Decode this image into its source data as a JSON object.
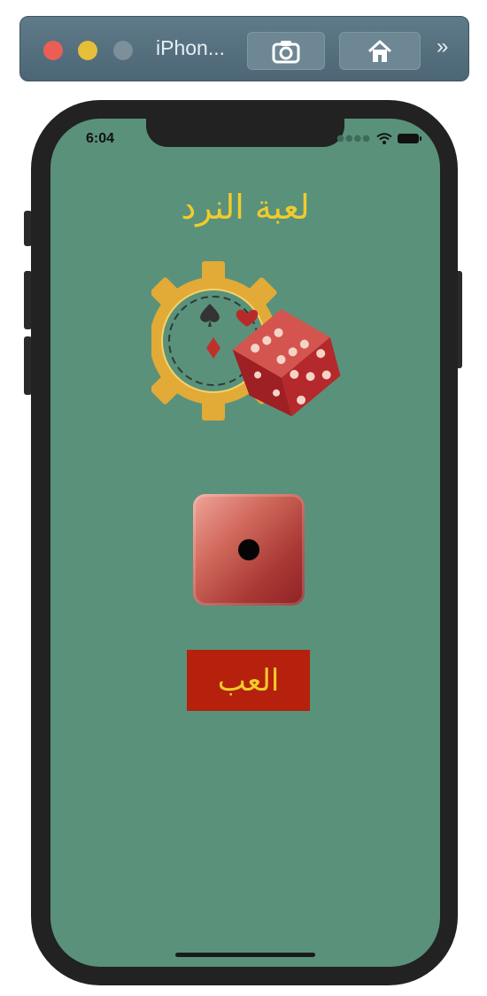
{
  "simulator": {
    "device_name": "iPhon...",
    "icons": {
      "close": "close-traffic-light",
      "minimize": "minimize-traffic-light",
      "zoom": "zoom-traffic-light",
      "screenshot": "camera-icon",
      "home": "home-icon",
      "more": "chevrons-right-icon"
    },
    "more_glyph": "»"
  },
  "status_bar": {
    "time": "6:04",
    "icons": [
      "signal-icon",
      "wifi-icon",
      "battery-icon"
    ]
  },
  "app": {
    "title": "لعبة النرد",
    "play_label": "العب",
    "die_face": 1,
    "colors": {
      "background": "#5a917b",
      "title": "#f1cb2c",
      "button": "#b5210c",
      "button_text": "#f1cb2c"
    }
  }
}
